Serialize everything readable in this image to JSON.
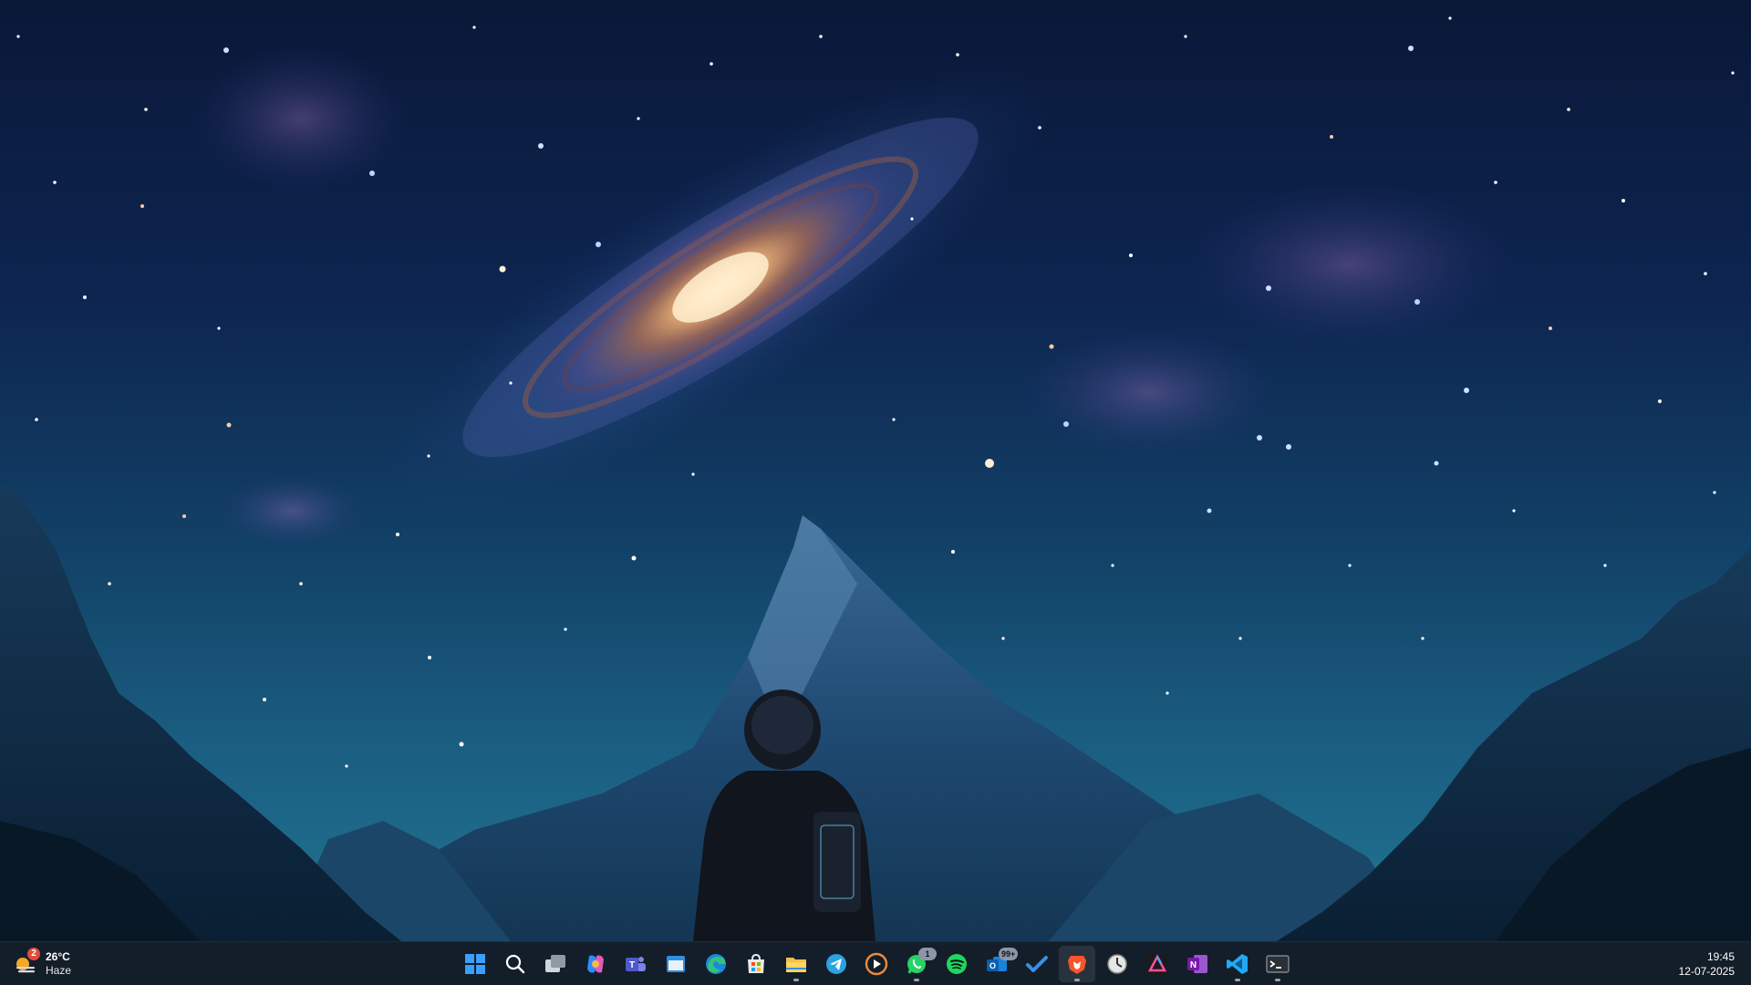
{
  "weather": {
    "temperature": "26°C",
    "condition": "Haze",
    "badge": "2"
  },
  "taskbar": {
    "apps": [
      {
        "id": "start",
        "name": "Start",
        "icon": "windows-logo-icon"
      },
      {
        "id": "search",
        "name": "Search",
        "icon": "search-icon"
      },
      {
        "id": "task-view",
        "name": "Task View",
        "icon": "task-view-icon"
      },
      {
        "id": "copilot",
        "name": "Copilot",
        "icon": "copilot-icon"
      },
      {
        "id": "teams",
        "name": "Microsoft Teams",
        "icon": "teams-icon"
      },
      {
        "id": "widgets",
        "name": "App",
        "icon": "window-app-icon"
      },
      {
        "id": "edge",
        "name": "Microsoft Edge",
        "icon": "edge-icon"
      },
      {
        "id": "store",
        "name": "Microsoft Store",
        "icon": "store-icon"
      },
      {
        "id": "file-explorer",
        "name": "File Explorer",
        "icon": "folder-icon",
        "running": true
      },
      {
        "id": "telegram",
        "name": "Telegram",
        "icon": "telegram-icon"
      },
      {
        "id": "media-player",
        "name": "Media Player",
        "icon": "play-icon"
      },
      {
        "id": "whatsapp",
        "name": "WhatsApp",
        "icon": "whatsapp-icon",
        "badge": "1",
        "running": true
      },
      {
        "id": "spotify",
        "name": "Spotify",
        "icon": "spotify-icon"
      },
      {
        "id": "outlook",
        "name": "Outlook",
        "icon": "outlook-icon",
        "badge": "99+"
      },
      {
        "id": "todo",
        "name": "Microsoft To Do",
        "icon": "checkmark-icon"
      },
      {
        "id": "brave",
        "name": "Brave",
        "icon": "brave-lion-icon",
        "active": true,
        "running": true
      },
      {
        "id": "clock-app",
        "name": "Clock",
        "icon": "clock-icon"
      },
      {
        "id": "affinity",
        "name": "Affinity",
        "icon": "affinity-icon"
      },
      {
        "id": "onenote",
        "name": "OneNote",
        "icon": "onenote-icon"
      },
      {
        "id": "vscode",
        "name": "Visual Studio Code",
        "icon": "vscode-icon",
        "running": true
      },
      {
        "id": "terminal",
        "name": "Terminal",
        "icon": "terminal-icon",
        "running": true
      }
    ]
  },
  "clock": {
    "time": "19:45",
    "date": "12-07-2025"
  }
}
